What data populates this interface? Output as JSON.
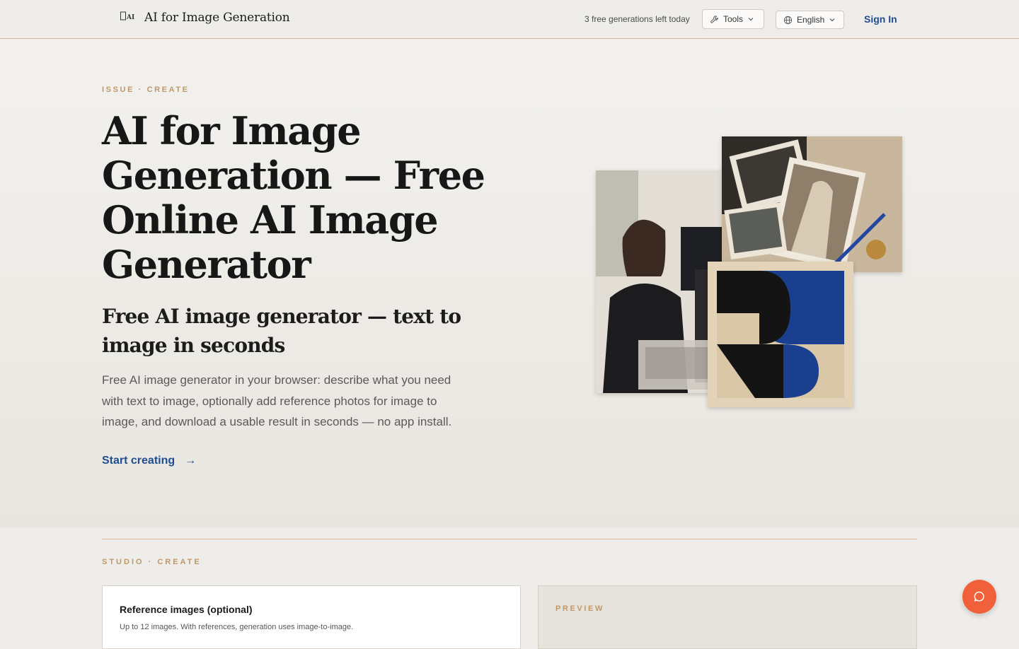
{
  "header": {
    "brand_title": "AI for Image Generation",
    "free_generations": "3 free generations left today",
    "tools_label": "Tools",
    "language_label": "English",
    "sign_in": "Sign In"
  },
  "hero": {
    "eyebrow": "ISSUE · CREATE",
    "title": "AI for Image Generation — Free Online AI Image Generator",
    "subtitle": "Free AI image generator — text to image in seconds",
    "description": "Free AI image generator in your browser: describe what you need with text to image, optionally add reference photos for image to image, and download a usable result in seconds — no app install.",
    "cta_label": "Start creating",
    "cta_arrow": "→"
  },
  "studio": {
    "eyebrow": "STUDIO · CREATE",
    "reference_title": "Reference images (optional)",
    "reference_hint": "Up to 12 images. With references, generation uses image-to-image.",
    "preview_label": "PREVIEW"
  },
  "icons": {
    "logo": "ai-logo-icon",
    "tools": "wrench-icon",
    "language": "globe-icon",
    "chevron": "chevron-down-icon",
    "chat": "chat-bubble-icon"
  },
  "colors": {
    "accent_blue": "#1f4d8f",
    "eyebrow_tan": "#c19867",
    "chat_orange": "#f0603a",
    "divider": "#d7b99b"
  }
}
